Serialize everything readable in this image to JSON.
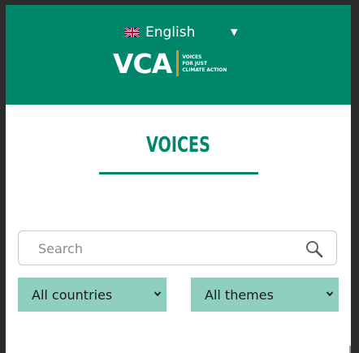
{
  "header": {
    "language": "English",
    "logo": {
      "mark": "VCA",
      "tagline": [
        "VOICES",
        "FOR JUST",
        "CLIMATE ACTION"
      ]
    }
  },
  "page": {
    "title": "VOICES"
  },
  "search": {
    "placeholder": "Search",
    "value": ""
  },
  "filters": {
    "countries": "All countries",
    "themes": "All themes"
  },
  "colors": {
    "brand_green": "#00876b",
    "filter_bg": "#8fcfbf",
    "logo_accent": "#f08a24"
  }
}
